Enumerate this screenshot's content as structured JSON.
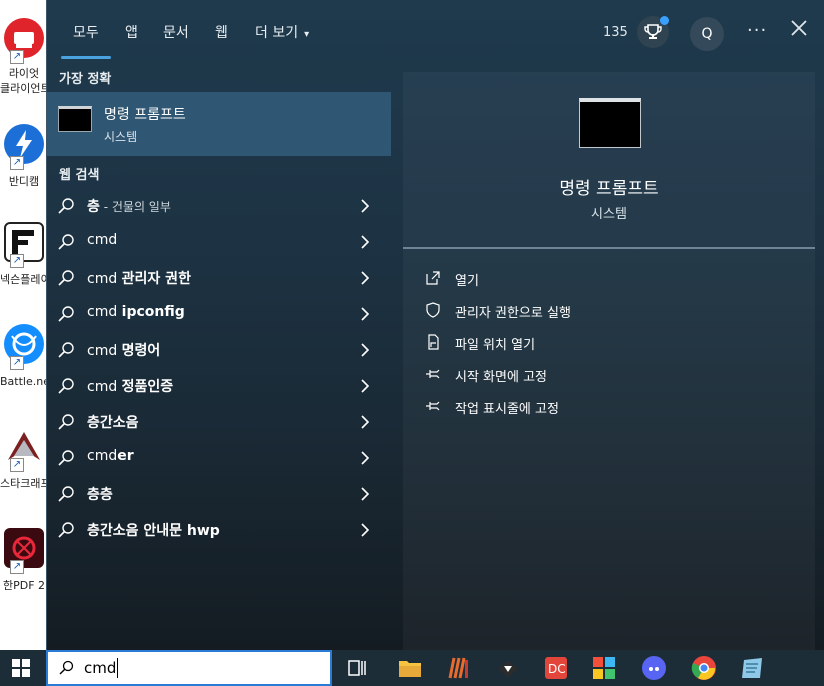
{
  "desktop": {
    "icons": [
      {
        "name": "라이엇 클라이언트",
        "line1": "라이엇",
        "line2": "클라이언트"
      },
      {
        "name": "반디캠",
        "line1": "반디캠",
        "line2": ""
      },
      {
        "name": "넥슨플레이",
        "line1": "넥슨플레이",
        "line2": ""
      },
      {
        "name": "Battle.net",
        "line1": "Battle.net",
        "line2": ""
      },
      {
        "name": "스타크래프트",
        "line1": "스타크래프트",
        "line2": ""
      },
      {
        "name": "한PDF 2",
        "line1": "한PDF 2",
        "line2": ""
      }
    ]
  },
  "nav": {
    "tabs": [
      "모두",
      "앱",
      "문서",
      "웹",
      "더 보기"
    ],
    "more_caret": "▾",
    "points": "135",
    "user_initial": "Q",
    "more_menu": "···"
  },
  "best_match": {
    "heading": "가장 정확",
    "name": "명령 프롬프트",
    "type": "시스템"
  },
  "web_search": {
    "heading": "웹 검색",
    "items": [
      {
        "prefix": "",
        "bold": "층",
        "suffix": " - ",
        "sub": "건물의 일부"
      },
      {
        "prefix": "cmd",
        "bold": "",
        "suffix": "",
        "sub": ""
      },
      {
        "prefix": "cmd ",
        "bold": "관리자 권한",
        "suffix": "",
        "sub": ""
      },
      {
        "prefix": "cmd ",
        "bold": "ipconfig",
        "suffix": "",
        "sub": ""
      },
      {
        "prefix": "cmd ",
        "bold": "명령어",
        "suffix": "",
        "sub": ""
      },
      {
        "prefix": "cmd ",
        "bold": "정품인증",
        "suffix": "",
        "sub": ""
      },
      {
        "prefix": "",
        "bold": "층간소음",
        "suffix": "",
        "sub": ""
      },
      {
        "prefix": "cmd",
        "bold": "er",
        "suffix": "",
        "sub": ""
      },
      {
        "prefix": "",
        "bold": "층층",
        "suffix": "",
        "sub": ""
      },
      {
        "prefix": "",
        "bold": "층간소음 안내문 hwp",
        "suffix": "",
        "sub": ""
      }
    ]
  },
  "detail": {
    "name": "명령 프롬프트",
    "type": "시스템",
    "actions": [
      {
        "label": "열기",
        "icon": "open-icon"
      },
      {
        "label": "관리자 권한으로 실행",
        "icon": "shield-icon"
      },
      {
        "label": "파일 위치 열기",
        "icon": "file-location-icon"
      },
      {
        "label": "시작 화면에 고정",
        "icon": "pin-icon"
      },
      {
        "label": "작업 표시줄에 고정",
        "icon": "pin-icon"
      }
    ]
  },
  "taskbar": {
    "search_value": "cmd"
  },
  "colors": {
    "panel": "#1d3344",
    "selected": "#2f5673",
    "accent": "#4aa3e0",
    "taskbar": "#1d2d38"
  }
}
